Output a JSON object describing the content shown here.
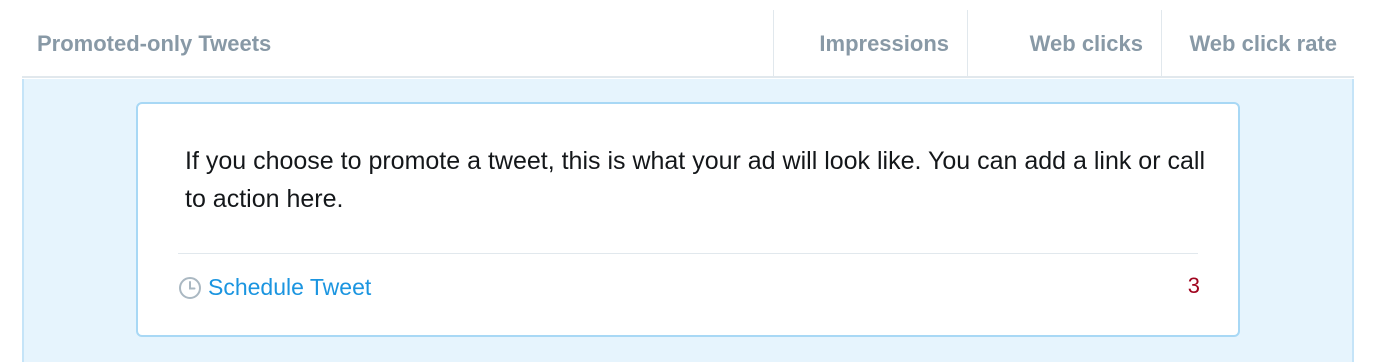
{
  "table": {
    "columns": [
      {
        "label": "Promoted-only Tweets"
      },
      {
        "label": "Impressions"
      },
      {
        "label": "Web clicks"
      },
      {
        "label": "Web click rate"
      }
    ]
  },
  "tweet_preview": {
    "text": "If you choose to promote a tweet, this is what your ad will look like. You can add a link or call to action here.",
    "schedule_label": "Schedule Tweet",
    "character_count": "3",
    "icon": "clock-icon"
  },
  "colors": {
    "header_text": "#8899a6",
    "panel_background": "#e6f4fd",
    "card_border": "#a8d8f5",
    "link": "#1b95e0",
    "count": "#a0041e"
  }
}
